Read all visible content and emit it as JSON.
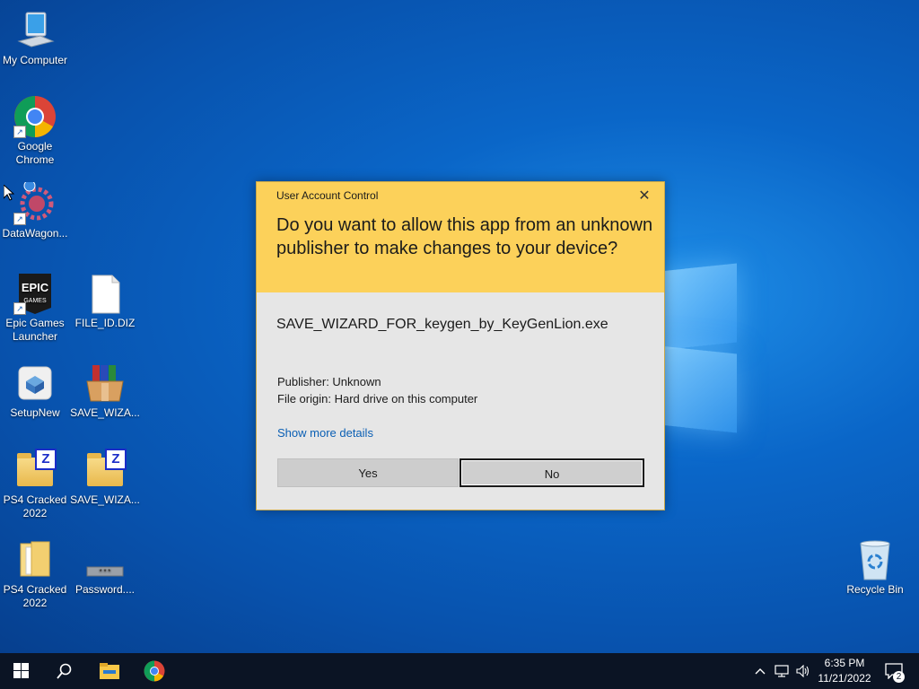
{
  "desktop": {
    "icons": [
      {
        "label": "My Computer"
      },
      {
        "label": "Google Chrome"
      },
      {
        "label": "DataWagon..."
      },
      {
        "label": "Epic Games Launcher"
      },
      {
        "label": "FILE_ID.DIZ"
      },
      {
        "label": "SetupNew"
      },
      {
        "label": "SAVE_WIZA..."
      },
      {
        "label": "PS4 Cracked 2022"
      },
      {
        "label": "SAVE_WIZA..."
      },
      {
        "label": "PS4 Cracked 2022"
      },
      {
        "label": "Password...."
      },
      {
        "label": "Recycle Bin"
      }
    ]
  },
  "uac": {
    "title": "User Account Control",
    "question": "Do you want to allow this app from an unknown publisher to make changes to your device?",
    "app_name": "SAVE_WIZARD_FOR_keygen_by_KeyGenLion.exe",
    "publisher": "Publisher: Unknown",
    "file_origin": "File origin: Hard drive on this computer",
    "show_more": "Show more details",
    "yes_label": "Yes",
    "no_label": "No",
    "close_glyph": "✕",
    "header_color": "#fcd15a",
    "link_color": "#0a5fb4"
  },
  "taskbar": {
    "clock_time": "6:35 PM",
    "clock_date": "11/21/2022",
    "notification_count": "2",
    "pinned": [
      "start-icon",
      "search-icon",
      "file-explorer-icon",
      "chrome-icon"
    ],
    "tray": [
      "chevron-up-icon",
      "network-icon",
      "volume-icon"
    ]
  }
}
